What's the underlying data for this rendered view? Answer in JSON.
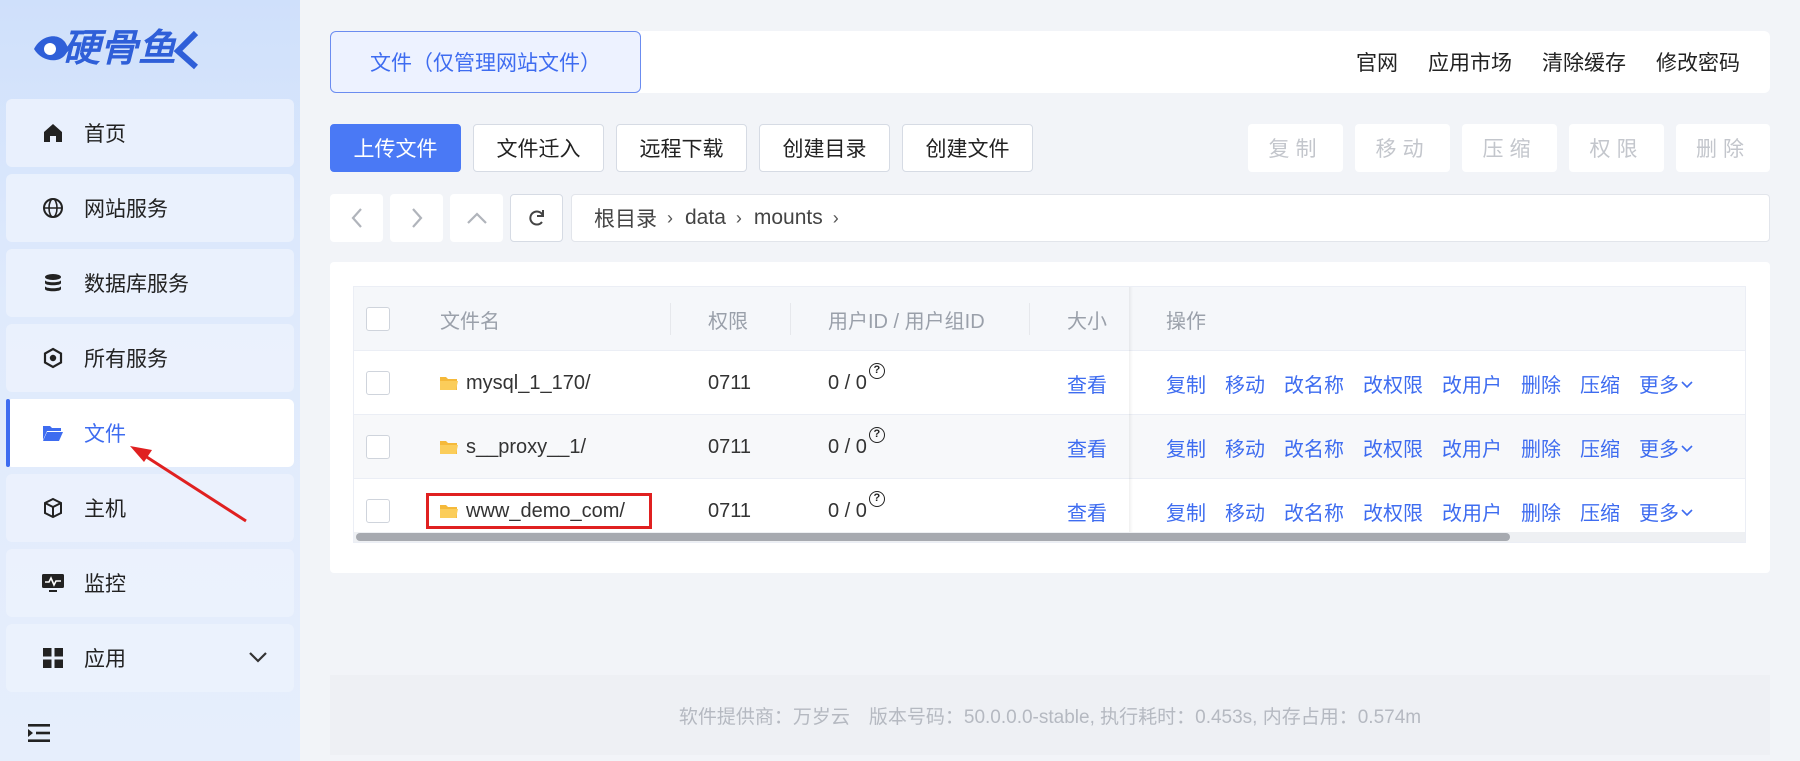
{
  "brand": {
    "logo_text": "硬骨鱼",
    "accent": "#3e6cf0",
    "primary_button": "#4a79f5"
  },
  "sidebar": {
    "items": [
      {
        "label": "首页",
        "icon": "home-icon"
      },
      {
        "label": "网站服务",
        "icon": "globe-icon"
      },
      {
        "label": "数据库服务",
        "icon": "database-icon"
      },
      {
        "label": "所有服务",
        "icon": "services-icon"
      },
      {
        "label": "文件",
        "icon": "folder-open-icon",
        "active": true
      },
      {
        "label": "主机",
        "icon": "host-cube-icon"
      },
      {
        "label": "监控",
        "icon": "monitor-icon"
      },
      {
        "label": "应用",
        "icon": "apps-grid-icon",
        "expandable": true
      }
    ]
  },
  "header": {
    "tab": "文件（仅管理网站文件）",
    "links": [
      "官网",
      "应用市场",
      "清除缓存",
      "修改密码"
    ]
  },
  "toolbar": {
    "upload": "上传文件",
    "import": "文件迁入",
    "remote_download": "远程下载",
    "create_dir": "创建目录",
    "create_file": "创建文件",
    "copy": "复制",
    "move": "移动",
    "compress": "压缩",
    "permission": "权限",
    "delete": "删除"
  },
  "path": {
    "root": "根目录",
    "segments": [
      "data",
      "mounts"
    ]
  },
  "table": {
    "headers": {
      "name": "文件名",
      "perm": "权限",
      "owner": "用户ID / 用户组ID",
      "size": "大小",
      "actions": "操作"
    },
    "rows": [
      {
        "name": "mysql_1_170/",
        "perm": "0711",
        "owner": "0 / 0",
        "size": "查看"
      },
      {
        "name": "s__proxy__1/",
        "perm": "0711",
        "owner": "0 / 0",
        "size": "查看"
      },
      {
        "name": "www_demo_com/",
        "perm": "0711",
        "owner": "0 / 0",
        "size": "查看",
        "highlighted": true
      }
    ],
    "row_actions": [
      "复制",
      "移动",
      "改名称",
      "改权限",
      "改用户",
      "删除",
      "压缩",
      "更多"
    ]
  },
  "footer": {
    "text": "软件提供商：万岁云　版本号码：50.0.0.0-stable, 执行耗时：0.453s, 内存占用：0.574m"
  }
}
